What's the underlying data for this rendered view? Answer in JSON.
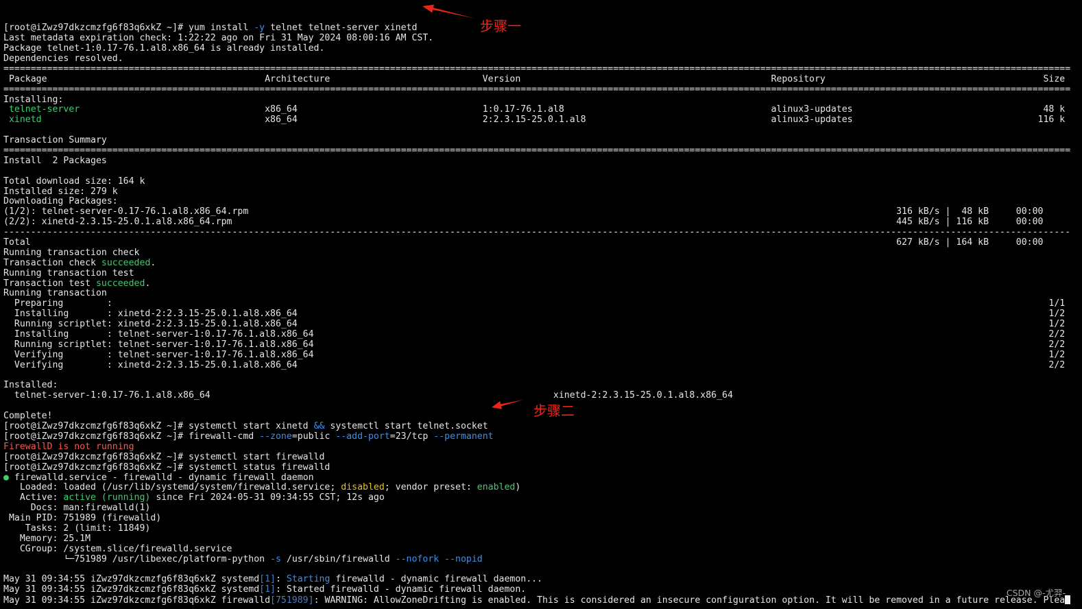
{
  "terminal": {
    "colors": {
      "background": "#000000",
      "foreground": "#e6e6e6",
      "cursor": "#f0f0f0"
    },
    "lines": [
      [
        {
          "text": "[root@iZwz97dkzcmzfg6f83q6xkZ ~]# yum install "
        },
        {
          "text": "-y",
          "color": "#3f8fea"
        },
        {
          "text": " telnet telnet-server xinetd"
        }
      ],
      [
        {
          "text": "Last metadata expiration check: 1:22:22 ago on Fri 31 May 2024 08:00:16 AM CST."
        }
      ],
      [
        {
          "text": "Package telnet-1:0.17-76.1.al8.x86_64 is already installed."
        }
      ],
      [
        {
          "text": "Dependencies resolved."
        }
      ],
      [
        {
          "text": "===================================================================================================================================================================================================="
        }
      ],
      [
        {
          "text": " Package                                        Architecture                            Version                                              Repository                                        Size"
        }
      ],
      [
        {
          "text": "===================================================================================================================================================================================================="
        }
      ],
      [
        {
          "text": "Installing:"
        }
      ],
      [
        {
          "text": " "
        },
        {
          "text": "telnet-server",
          "color": "#3ccf6e"
        },
        {
          "text": "                                  x86_64                                  1:0.17-76.1.al8                                      alinux3-updates                                   48 k"
        }
      ],
      [
        {
          "text": " "
        },
        {
          "text": "xinetd",
          "color": "#3ccf6e"
        },
        {
          "text": "                                         x86_64                                  2:2.3.15-25.0.1.al8                                  alinux3-updates                                  116 k"
        }
      ],
      [],
      [
        {
          "text": "Transaction Summary"
        }
      ],
      [
        {
          "text": "===================================================================================================================================================================================================="
        }
      ],
      [
        {
          "text": "Install  2 Packages"
        }
      ],
      [],
      [
        {
          "text": "Total download size: 164 k"
        }
      ],
      [
        {
          "text": "Installed size: 279 k"
        }
      ],
      [
        {
          "text": "Downloading Packages:"
        }
      ],
      [
        {
          "text": "(1/2): telnet-server-0.17-76.1.al8.x86_64.rpm                                                                                                                       316 kB/s |  48 kB     00:00"
        }
      ],
      [
        {
          "text": "(2/2): xinetd-2.3.15-25.0.1.al8.x86_64.rpm                                                                                                                          445 kB/s | 116 kB     00:00"
        }
      ],
      [
        {
          "text": "----------------------------------------------------------------------------------------------------------------------------------------------------------------------------------------------------"
        }
      ],
      [
        {
          "text": "Total                                                                                                                                                               627 kB/s | 164 kB     00:00"
        }
      ],
      [
        {
          "text": "Running transaction check"
        }
      ],
      [
        {
          "text": "Transaction check "
        },
        {
          "text": "succeeded",
          "color": "#3ccf6e"
        },
        {
          "text": "."
        }
      ],
      [
        {
          "text": "Running transaction test"
        }
      ],
      [
        {
          "text": "Transaction test "
        },
        {
          "text": "succeeded",
          "color": "#3ccf6e"
        },
        {
          "text": "."
        }
      ],
      [
        {
          "text": "Running transaction"
        }
      ],
      [
        {
          "text": "  Preparing        :                                                                                                                                                                            1/1"
        }
      ],
      [
        {
          "text": "  Installing       : xinetd-2:2.3.15-25.0.1.al8.x86_64                                                                                                                                          1/2"
        }
      ],
      [
        {
          "text": "  Running scriptlet: xinetd-2:2.3.15-25.0.1.al8.x86_64                                                                                                                                          1/2"
        }
      ],
      [
        {
          "text": "  Installing       : telnet-server-1:0.17-76.1.al8.x86_64                                                                                                                                       2/2"
        }
      ],
      [
        {
          "text": "  Running scriptlet: telnet-server-1:0.17-76.1.al8.x86_64                                                                                                                                       2/2"
        }
      ],
      [
        {
          "text": "  Verifying        : telnet-server-1:0.17-76.1.al8.x86_64                                                                                                                                       1/2"
        }
      ],
      [
        {
          "text": "  Verifying        : xinetd-2:2.3.15-25.0.1.al8.x86_64                                                                                                                                          2/2"
        }
      ],
      [],
      [
        {
          "text": "Installed:"
        }
      ],
      [
        {
          "text": "  telnet-server-1:0.17-76.1.al8.x86_64                                                               xinetd-2:2.3.15-25.0.1.al8.x86_64"
        }
      ],
      [],
      [
        {
          "text": "Complete!"
        }
      ],
      [
        {
          "text": "[root@iZwz97dkzcmzfg6f83q6xkZ ~]# systemctl start xinetd "
        },
        {
          "text": "&&",
          "color": "#3f8fea"
        },
        {
          "text": " systemctl start telnet.socket"
        }
      ],
      [
        {
          "text": "[root@iZwz97dkzcmzfg6f83q6xkZ ~]# firewall-cmd "
        },
        {
          "text": "--zone",
          "color": "#3f8fea"
        },
        {
          "text": "=public "
        },
        {
          "text": "--add-port",
          "color": "#3f8fea"
        },
        {
          "text": "=23/tcp "
        },
        {
          "text": "--permanent",
          "color": "#3f8fea"
        }
      ],
      [
        {
          "text": "FirewallD is not running",
          "color": "#f25a52"
        }
      ],
      [
        {
          "text": "[root@iZwz97dkzcmzfg6f83q6xkZ ~]# systemctl start firewalld"
        }
      ],
      [
        {
          "text": "[root@iZwz97dkzcmzfg6f83q6xkZ ~]# systemctl status firewalld"
        }
      ],
      [
        {
          "text": "●",
          "color": "#3ccf6e"
        },
        {
          "text": " firewalld.service - firewalld - dynamic firewall daemon"
        }
      ],
      [
        {
          "text": "   Loaded: loaded (/usr/lib/systemd/system/firewalld.service; "
        },
        {
          "text": "disabled",
          "color": "#e3c22a"
        },
        {
          "text": "; vendor preset: "
        },
        {
          "text": "enabled",
          "color": "#3ccf6e"
        },
        {
          "text": ")"
        }
      ],
      [
        {
          "text": "   Active: "
        },
        {
          "text": "active (running)",
          "color": "#3ccf6e"
        },
        {
          "text": " since Fri 2024-05-31 09:34:55 CST; 12s ago"
        }
      ],
      [
        {
          "text": "     Docs: man:firewalld(1)"
        }
      ],
      [
        {
          "text": " Main PID: 751989 (firewalld)"
        }
      ],
      [
        {
          "text": "    Tasks: 2 (limit: 11849)"
        }
      ],
      [
        {
          "text": "   Memory: 25.1M"
        }
      ],
      [
        {
          "text": "   CGroup: /system.slice/firewalld.service"
        }
      ],
      [
        {
          "text": "           └─751989 /usr/libexec/platform-python "
        },
        {
          "text": "-s",
          "color": "#3f8fea"
        },
        {
          "text": " /usr/sbin/firewalld "
        },
        {
          "text": "--nofork",
          "color": "#3f8fea"
        },
        {
          "text": " "
        },
        {
          "text": "--nopid",
          "color": "#3f8fea"
        }
      ],
      [],
      [
        {
          "text": "May 31 09:34:55 iZwz97dkzcmzfg6f83q6xkZ systemd"
        },
        {
          "text": "[1]",
          "color": "#4a7cc0"
        },
        {
          "text": ": "
        },
        {
          "text": "Starting",
          "color": "#3f8fea"
        },
        {
          "text": " firewalld - dynamic firewall daemon..."
        }
      ],
      [
        {
          "text": "May 31 09:34:55 iZwz97dkzcmzfg6f83q6xkZ systemd"
        },
        {
          "text": "[1]",
          "color": "#4a7cc0"
        },
        {
          "text": ": Started firewalld - dynamic firewall daemon."
        }
      ],
      [
        {
          "text": "May 31 09:34:55 iZwz97dkzcmzfg6f83q6xkZ firewalld"
        },
        {
          "text": "[751989]",
          "color": "#4a7cc0"
        },
        {
          "text": ": WARNING: AllowZoneDrifting is enabled. This is considered an insecure configuration option. It will be removed in a future release. Plea"
        }
      ]
    ]
  },
  "annotations": {
    "color": "#e8261a",
    "items": [
      {
        "label": "步骤一"
      },
      {
        "label": "步骤二"
      }
    ]
  },
  "watermark": {
    "text": "CSDN @-尤羿-"
  }
}
